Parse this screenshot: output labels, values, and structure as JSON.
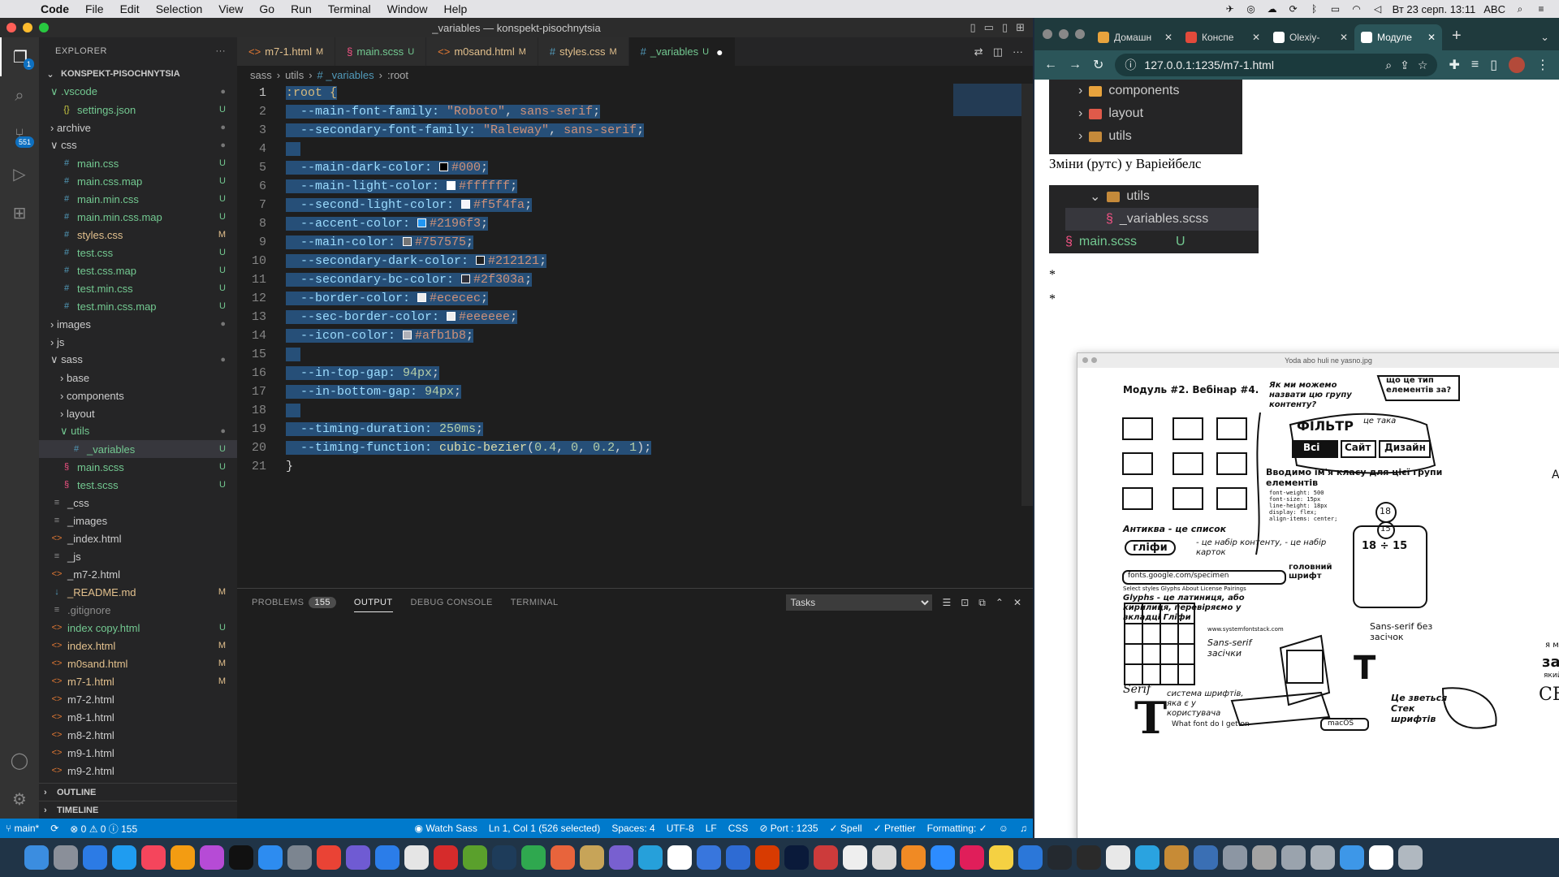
{
  "menubar": {
    "app": "Code",
    "items": [
      "File",
      "Edit",
      "Selection",
      "View",
      "Go",
      "Run",
      "Terminal",
      "Window",
      "Help"
    ],
    "datetime": "Вт 23 серп.  13:11",
    "input_lang": "ABC"
  },
  "vscode": {
    "window_title": "_variables — konspekt-pisochnytsia",
    "activity_badges": {
      "source_control": "551",
      "explorer": "1"
    },
    "explorer": {
      "title": "EXPLORER",
      "root": "KONSPEKT-PISOCHNYTSIA",
      "tree": [
        {
          "label": "∨ .vscode",
          "indent": 0,
          "kind": "folder",
          "color": "green",
          "status": "●"
        },
        {
          "label": "settings.json",
          "indent": 1,
          "kind": "json",
          "color": "green",
          "status": "U"
        },
        {
          "label": "› archive",
          "indent": 0,
          "kind": "folder",
          "color": "",
          "status": "●"
        },
        {
          "label": "∨ css",
          "indent": 0,
          "kind": "folder",
          "color": "",
          "status": "●"
        },
        {
          "label": "main.css",
          "indent": 1,
          "kind": "css",
          "color": "green",
          "status": "U"
        },
        {
          "label": "main.css.map",
          "indent": 1,
          "kind": "css",
          "color": "green",
          "status": "U"
        },
        {
          "label": "main.min.css",
          "indent": 1,
          "kind": "css",
          "color": "green",
          "status": "U"
        },
        {
          "label": "main.min.css.map",
          "indent": 1,
          "kind": "css",
          "color": "green",
          "status": "U"
        },
        {
          "label": "styles.css",
          "indent": 1,
          "kind": "css",
          "color": "yellow",
          "status": "M"
        },
        {
          "label": "test.css",
          "indent": 1,
          "kind": "css",
          "color": "green",
          "status": "U"
        },
        {
          "label": "test.css.map",
          "indent": 1,
          "kind": "css",
          "color": "green",
          "status": "U"
        },
        {
          "label": "test.min.css",
          "indent": 1,
          "kind": "css",
          "color": "green",
          "status": "U"
        },
        {
          "label": "test.min.css.map",
          "indent": 1,
          "kind": "css",
          "color": "green",
          "status": "U"
        },
        {
          "label": "› images",
          "indent": 0,
          "kind": "folder",
          "color": "",
          "status": "●"
        },
        {
          "label": "› js",
          "indent": 0,
          "kind": "folder",
          "color": "",
          "status": ""
        },
        {
          "label": "∨ sass",
          "indent": 0,
          "kind": "folder",
          "color": "",
          "status": "●"
        },
        {
          "label": "› base",
          "indent": 1,
          "kind": "folder",
          "color": "",
          "status": ""
        },
        {
          "label": "› components",
          "indent": 1,
          "kind": "folder",
          "color": "",
          "status": ""
        },
        {
          "label": "› layout",
          "indent": 1,
          "kind": "folder",
          "color": "",
          "status": ""
        },
        {
          "label": "∨ utils",
          "indent": 1,
          "kind": "folder",
          "color": "green",
          "status": "●"
        },
        {
          "label": "_variables",
          "indent": 2,
          "kind": "css",
          "color": "green",
          "status": "U",
          "selected": true
        },
        {
          "label": "main.scss",
          "indent": 1,
          "kind": "sass",
          "color": "green",
          "status": "U"
        },
        {
          "label": "test.scss",
          "indent": 1,
          "kind": "sass",
          "color": "green",
          "status": "U"
        },
        {
          "label": "_css",
          "indent": 0,
          "kind": "file",
          "color": "",
          "status": ""
        },
        {
          "label": "_images",
          "indent": 0,
          "kind": "file",
          "color": "",
          "status": ""
        },
        {
          "label": "_index.html",
          "indent": 0,
          "kind": "html",
          "color": "",
          "status": ""
        },
        {
          "label": "_js",
          "indent": 0,
          "kind": "file",
          "color": "",
          "status": ""
        },
        {
          "label": "_m7-2.html",
          "indent": 0,
          "kind": "html",
          "color": "",
          "status": ""
        },
        {
          "label": "_README.md",
          "indent": 0,
          "kind": "md",
          "color": "yellow",
          "status": "M"
        },
        {
          "label": ".gitignore",
          "indent": 0,
          "kind": "file",
          "color": "gray",
          "status": ""
        },
        {
          "label": "index copy.html",
          "indent": 0,
          "kind": "html",
          "color": "green",
          "status": "U"
        },
        {
          "label": "index.html",
          "indent": 0,
          "kind": "html",
          "color": "yellow",
          "status": "M"
        },
        {
          "label": "m0sand.html",
          "indent": 0,
          "kind": "html",
          "color": "yellow",
          "status": "M"
        },
        {
          "label": "m7-1.html",
          "indent": 0,
          "kind": "html",
          "color": "yellow",
          "status": "M"
        },
        {
          "label": "m7-2.html",
          "indent": 0,
          "kind": "html",
          "color": "",
          "status": ""
        },
        {
          "label": "m8-1.html",
          "indent": 0,
          "kind": "html",
          "color": "",
          "status": ""
        },
        {
          "label": "m8-2.html",
          "indent": 0,
          "kind": "html",
          "color": "",
          "status": ""
        },
        {
          "label": "m9-1.html",
          "indent": 0,
          "kind": "html",
          "color": "",
          "status": ""
        },
        {
          "label": "m9-2.html",
          "indent": 0,
          "kind": "html",
          "color": "",
          "status": ""
        }
      ],
      "outline": "OUTLINE",
      "timeline": "TIMELINE"
    },
    "tabs": [
      {
        "label": "m7-1.html",
        "mod": "M",
        "kind": "html"
      },
      {
        "label": "main.scss",
        "mod": "U",
        "kind": "sass"
      },
      {
        "label": "m0sand.html",
        "mod": "M",
        "kind": "html"
      },
      {
        "label": "styles.css",
        "mod": "M",
        "kind": "css"
      },
      {
        "label": "_variables",
        "mod": "U",
        "kind": "css",
        "active": true
      }
    ],
    "breadcrumb": [
      "sass",
      "utils",
      "# _variables",
      ":root"
    ],
    "code_lines": [
      [
        {
          "t": ":root {",
          "c": "sel"
        }
      ],
      [
        {
          "t": "  --main-font-family: ",
          "c": "var"
        },
        {
          "t": "\"Roboto\"",
          "c": "str"
        },
        {
          "t": ", ",
          "c": "p"
        },
        {
          "t": "sans-serif",
          "c": "kw"
        },
        {
          "t": ";",
          "c": "p"
        }
      ],
      [
        {
          "t": "  --secondary-font-family: ",
          "c": "var"
        },
        {
          "t": "\"Raleway\"",
          "c": "str"
        },
        {
          "t": ", ",
          "c": "p"
        },
        {
          "t": "sans-serif",
          "c": "kw"
        },
        {
          "t": ";",
          "c": "p"
        }
      ],
      [],
      [
        {
          "t": "  --main-dark-color: ",
          "c": "var"
        },
        {
          "sw": "#000000"
        },
        {
          "t": "#000",
          "c": "str"
        },
        {
          "t": ";",
          "c": "p"
        }
      ],
      [
        {
          "t": "  --main-light-color: ",
          "c": "var"
        },
        {
          "sw": "#ffffff"
        },
        {
          "t": "#ffffff",
          "c": "str"
        },
        {
          "t": ";",
          "c": "p"
        }
      ],
      [
        {
          "t": "  --second-light-color: ",
          "c": "var"
        },
        {
          "sw": "#f5f4fa"
        },
        {
          "t": "#f5f4fa",
          "c": "str"
        },
        {
          "t": ";",
          "c": "p"
        }
      ],
      [
        {
          "t": "  --accent-color: ",
          "c": "var"
        },
        {
          "sw": "#2196f3"
        },
        {
          "t": "#2196f3",
          "c": "str"
        },
        {
          "t": ";",
          "c": "p"
        }
      ],
      [
        {
          "t": "  --main-color: ",
          "c": "var"
        },
        {
          "sw": "#757575"
        },
        {
          "t": "#757575",
          "c": "str"
        },
        {
          "t": ";",
          "c": "p"
        }
      ],
      [
        {
          "t": "  --secondary-dark-color: ",
          "c": "var"
        },
        {
          "sw": "#212121"
        },
        {
          "t": "#212121",
          "c": "str"
        },
        {
          "t": ";",
          "c": "p"
        }
      ],
      [
        {
          "t": "  --secondary-bc-color: ",
          "c": "var"
        },
        {
          "sw": "#2f303a"
        },
        {
          "t": "#2f303a",
          "c": "str"
        },
        {
          "t": ";",
          "c": "p"
        }
      ],
      [
        {
          "t": "  --border-color: ",
          "c": "var"
        },
        {
          "sw": "#ececec"
        },
        {
          "t": "#ececec",
          "c": "str"
        },
        {
          "t": ";",
          "c": "p"
        }
      ],
      [
        {
          "t": "  --sec-border-color: ",
          "c": "var"
        },
        {
          "sw": "#eeeeee"
        },
        {
          "t": "#eeeeee",
          "c": "str"
        },
        {
          "t": ";",
          "c": "p"
        }
      ],
      [
        {
          "t": "  --icon-color: ",
          "c": "var"
        },
        {
          "sw": "#afb1b8"
        },
        {
          "t": "#afb1b8",
          "c": "str"
        },
        {
          "t": ";",
          "c": "p"
        }
      ],
      [],
      [
        {
          "t": "  --in-top-gap: ",
          "c": "var"
        },
        {
          "t": "94px",
          "c": "num"
        },
        {
          "t": ";",
          "c": "p"
        }
      ],
      [
        {
          "t": "  --in-bottom-gap: ",
          "c": "var"
        },
        {
          "t": "94px",
          "c": "num"
        },
        {
          "t": ";",
          "c": "p"
        }
      ],
      [],
      [
        {
          "t": "  --timing-duration: ",
          "c": "var"
        },
        {
          "t": "250ms",
          "c": "num"
        },
        {
          "t": ";",
          "c": "p"
        }
      ],
      [
        {
          "t": "  --timing-function: ",
          "c": "var"
        },
        {
          "t": "cubic-bezier",
          "c": "fn"
        },
        {
          "t": "(",
          "c": "p"
        },
        {
          "t": "0.4",
          "c": "num"
        },
        {
          "t": ", ",
          "c": "p"
        },
        {
          "t": "0",
          "c": "num"
        },
        {
          "t": ", ",
          "c": "p"
        },
        {
          "t": "0.2",
          "c": "num"
        },
        {
          "t": ", ",
          "c": "p"
        },
        {
          "t": "1",
          "c": "num"
        },
        {
          "t": ");",
          "c": "p"
        }
      ],
      [
        {
          "t": "}",
          "c": "p"
        }
      ]
    ],
    "panel": {
      "tabs": [
        "PROBLEMS",
        "OUTPUT",
        "DEBUG CONSOLE",
        "TERMINAL"
      ],
      "active": "OUTPUT",
      "problems_count": "155",
      "output_select": "Tasks"
    },
    "statusbar": {
      "branch": "main*",
      "errors": "⊗ 0 ⚠ 0 ⓘ 155",
      "watch_sass": "Watch Sass",
      "position": "Ln 1, Col 1 (526 selected)",
      "spaces": "Spaces: 4",
      "encoding": "UTF-8",
      "eol": "LF",
      "language": "CSS",
      "port": "Port : 1235",
      "spell": "Spell",
      "prettier": "Prettier",
      "formatting": "Formatting: ✓"
    }
  },
  "chrome": {
    "tabs": [
      {
        "label": "Домашн",
        "color": "#e8a33d"
      },
      {
        "label": "Конспе",
        "color": "#e24a3b"
      },
      {
        "label": "Olexiy-",
        "color": "#ffffff"
      },
      {
        "label": "Модуле",
        "color": "#ffffff",
        "active": true
      }
    ],
    "url": "127.0.0.1:1235/m7-1.html",
    "page": {
      "tree_top": [
        "components",
        "layout",
        "utils"
      ],
      "caption": "Зміни (рутс) у Варіейбелс",
      "tree_bottom": [
        "utils",
        "_variables.scss",
        "main.scss"
      ],
      "tree_bottom_status": "U",
      "bullets": [
        "*",
        "*"
      ],
      "image_title": "Yoda abo huli ne yasno.jpg",
      "sketch": {
        "module": "Модуль #2. Вебінар #4.",
        "q1": "Як ми можемо назвати цю групу контенту?",
        "q2": "що це тип елементів за?",
        "filter": "ФІЛЬТР",
        "btn_all": "Всі",
        "btn_site": "Сайт",
        "btn_design": "Дизайн",
        "taka": "це така",
        "intro": "Вводимо ім'я класу для цієї групи елементів",
        "font_code": "font-weight: 500\nfont-size: 15px\nline-height: 18px\ndisplay: flex;\nalign-items: center;",
        "antykva": "Антиква - це список",
        "glyph": "гліфи",
        "glyph_note": "- це набір контенту, - це набір карток",
        "num_15": "15",
        "num_18": "18",
        "calc": "18 ÷ 15",
        "url": "fonts.google.com/specimen",
        "gf_tabs": "Select styles  Glyphs  About  License  Pairings",
        "head_font": "головний шрифт",
        "glyphs_note": "Glyphs - це латиниця, або кирилиця, перевіряємо у вкладці Гліфи",
        "sysfont": "www.systemfontstack.com",
        "sans_serif": "Sans-serif без засічок",
        "sans_left": "Sans-serif засічки",
        "serif": "Serif",
        "system": "система шрифтів, яка є у користувача",
        "what_font": "What font do I get on",
        "macos": "macOS",
        "stek": "Це зветься Стек шрифтів",
        "big_t": "T",
        "cut1": "Alpha",
        "cut2": "засі",
        "cut3": "СЕН",
        "cut4": "я мака",
        "cut5": "який у"
      }
    }
  }
}
